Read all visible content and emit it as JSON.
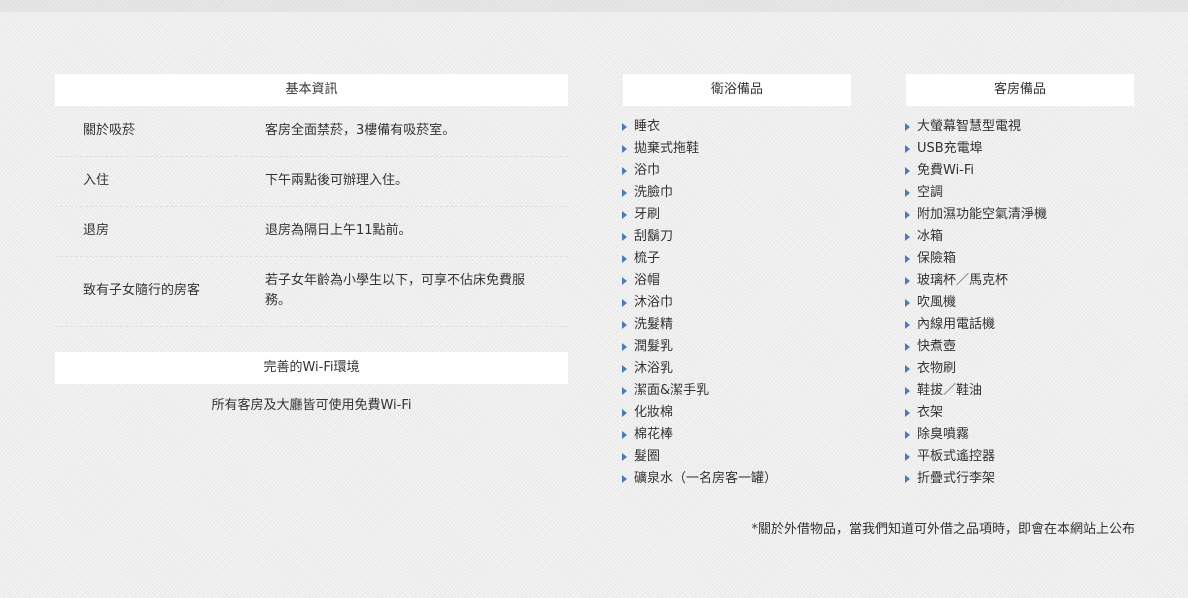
{
  "basic_info": {
    "title": "基本資訊",
    "rows": [
      {
        "label": "關於吸菸",
        "value": "客房全面禁菸，3樓備有吸菸室。"
      },
      {
        "label": "入住",
        "value": "下午兩點後可辦理入住。"
      },
      {
        "label": "退房",
        "value": "退房為隔日上午11點前。"
      },
      {
        "label": "致有子女隨行的房客",
        "value": "若子女年齡為小學生以下，可享不佔床免費服務。"
      }
    ]
  },
  "wifi": {
    "title": "完善的Wi-Fi環境",
    "text": "所有客房及大廳皆可使用免費Wi-Fi"
  },
  "bath": {
    "title": "衛浴備品",
    "items": [
      "睡衣",
      "拋棄式拖鞋",
      "浴巾",
      "洗臉巾",
      "牙刷",
      "刮鬍刀",
      "梳子",
      "浴帽",
      "沐浴巾",
      "洗髮精",
      "潤髮乳",
      "沐浴乳",
      "潔面&潔手乳",
      "化妝棉",
      "棉花棒",
      "髮圈",
      "礦泉水（一名房客一罐）"
    ]
  },
  "room": {
    "title": "客房備品",
    "items": [
      "大螢幕智慧型電視",
      "USB充電埠",
      "免費Wi-Fi",
      "空調",
      "附加濕功能空氣清淨機",
      "冰箱",
      "保險箱",
      "玻璃杯／馬克杯",
      "吹風機",
      "內線用電話機",
      "快煮壺",
      "衣物刷",
      "鞋拔／鞋油",
      "衣架",
      "除臭噴霧",
      "平板式遙控器",
      "折疊式行李架"
    ]
  },
  "footnote": "*關於外借物品，當我們知道可外借之品項時，即會在本網站上公布",
  "colors": {
    "bullet": "#4a7ab8",
    "header_bg": "#ffffff"
  },
  "icons": {
    "bullet": "triangle-right-icon"
  }
}
